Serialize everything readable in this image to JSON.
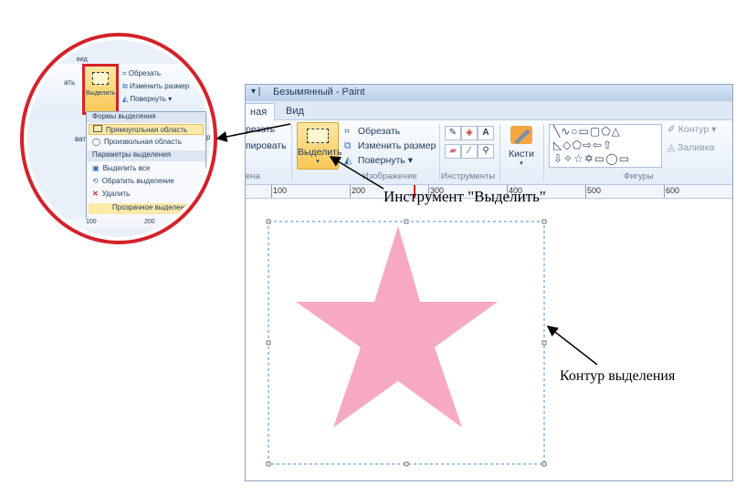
{
  "window": {
    "title": "Безымянный - Paint",
    "tabs": [
      {
        "label": "Главная",
        "visible_label": "ная",
        "active": true
      },
      {
        "label": "Вид",
        "active": false
      }
    ]
  },
  "ribbon": {
    "left_group_commands": [
      "резать",
      "пировать"
    ],
    "left_group_label": "ена",
    "select_button": {
      "label": "Выделить",
      "arrow": "▾"
    },
    "image_commands": {
      "crop": "Обрезать",
      "resize": "Изменить размер",
      "rotate": "Повернуть ▾"
    },
    "image_group_label": "Изображение",
    "tools_group_label": "Инструменты",
    "brushes_label": "Кисти",
    "brushes_arrow": "▾",
    "shapes_group_label": "Фигуры",
    "outline_label": "Контур ▾",
    "fill_label": "Заливка",
    "shape_rows": [
      "╲∿○▭▢⬠△",
      "◺◇⬠⇨⇦⇧",
      "⇩✧☆✡▭◯▭"
    ]
  },
  "ruler": {
    "ticks": [
      "100",
      "200",
      "300",
      "400",
      "500",
      "600"
    ]
  },
  "callout": {
    "top_text": "вид",
    "crop": "Обрезать",
    "resize": "Изменить размер",
    "rotate": "Повернуть ▾",
    "select_label": "Выделить",
    "side_left": [
      "ать",
      "ват"
    ],
    "side_right": [
      "р"
    ],
    "menu": {
      "header1": "Формы выделения",
      "rect": "Прямоугольная область",
      "free": "Произвольная область",
      "header2": "Параметры выделения",
      "select_all": "Выделить все",
      "invert": "Обратить выделение",
      "delete": "Удалить",
      "transparent": "Прозрачное выделение"
    },
    "ruler_ticks": [
      "100",
      "200"
    ]
  },
  "annotations": {
    "tool_label": "Инструмент \"Выделить\"",
    "selection_label": "Контур выделения"
  },
  "colors": {
    "star": "#f7a9c4",
    "callout_ring": "#d4222a",
    "selection_dash": "#3f8fd6",
    "select_button": "#f8c855"
  }
}
